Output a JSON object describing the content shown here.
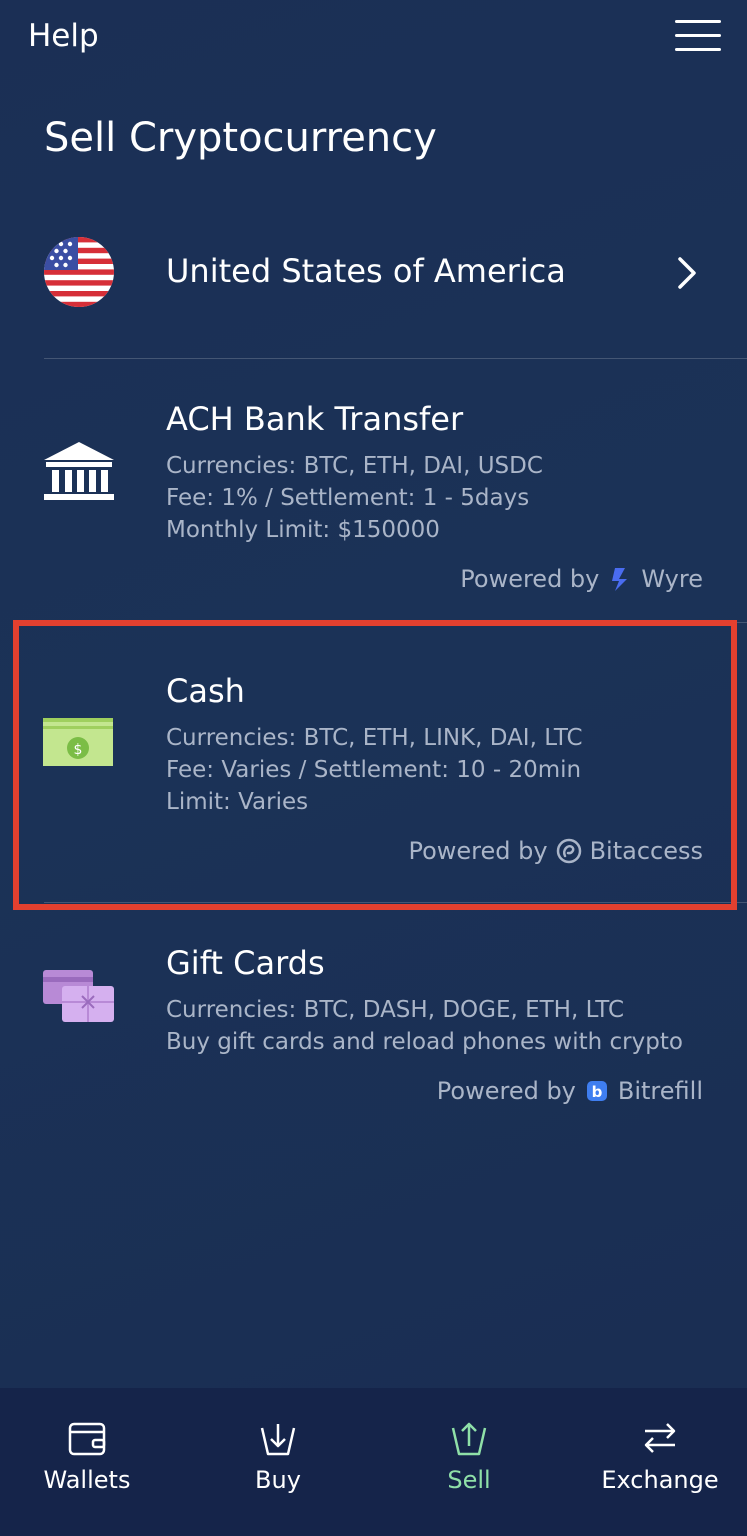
{
  "header": {
    "help_label": "Help",
    "menu_icon": "hamburger-menu-icon"
  },
  "page": {
    "title": "Sell Cryptocurrency"
  },
  "country": {
    "name": "United States of America",
    "flag_icon": "us-flag-icon",
    "chevron_icon": "chevron-right-icon"
  },
  "options": [
    {
      "title": "ACH Bank Transfer",
      "icon": "bank-icon",
      "lines": [
        "Currencies: BTC, ETH, DAI, USDC",
        "Fee: 1% / Settlement: 1 - 5days",
        "Monthly Limit: $150000"
      ],
      "powered_by_label": "Powered by",
      "provider": "Wyre",
      "provider_icon": "wyre-logo-icon"
    },
    {
      "title": "Cash",
      "icon": "cash-icon",
      "lines": [
        "Currencies: BTC, ETH, LINK, DAI, LTC",
        "Fee: Varies / Settlement: 10 - 20min",
        "Limit: Varies"
      ],
      "powered_by_label": "Powered by",
      "provider": "Bitaccess",
      "provider_icon": "bitaccess-logo-icon",
      "highlighted": true,
      "highlight_color": "#e3402f"
    },
    {
      "title": "Gift Cards",
      "icon": "gift-card-icon",
      "lines": [
        "Currencies: BTC, DASH, DOGE, ETH, LTC",
        "Buy gift cards and reload phones with crypto"
      ],
      "powered_by_label": "Powered by",
      "provider": "Bitrefill",
      "provider_icon": "bitrefill-logo-icon"
    }
  ],
  "tabbar": {
    "tabs": [
      {
        "label": "Wallets",
        "icon": "wallet-icon",
        "active": false
      },
      {
        "label": "Buy",
        "icon": "buy-download-icon",
        "active": false
      },
      {
        "label": "Sell",
        "icon": "sell-upload-icon",
        "active": true
      },
      {
        "label": "Exchange",
        "icon": "exchange-arrows-icon",
        "active": false
      }
    ],
    "active_color": "#8fe0a8"
  },
  "colors": {
    "background": "#1b3257",
    "tabbar_background": "#15244a",
    "muted_text": "#aab5c8"
  }
}
